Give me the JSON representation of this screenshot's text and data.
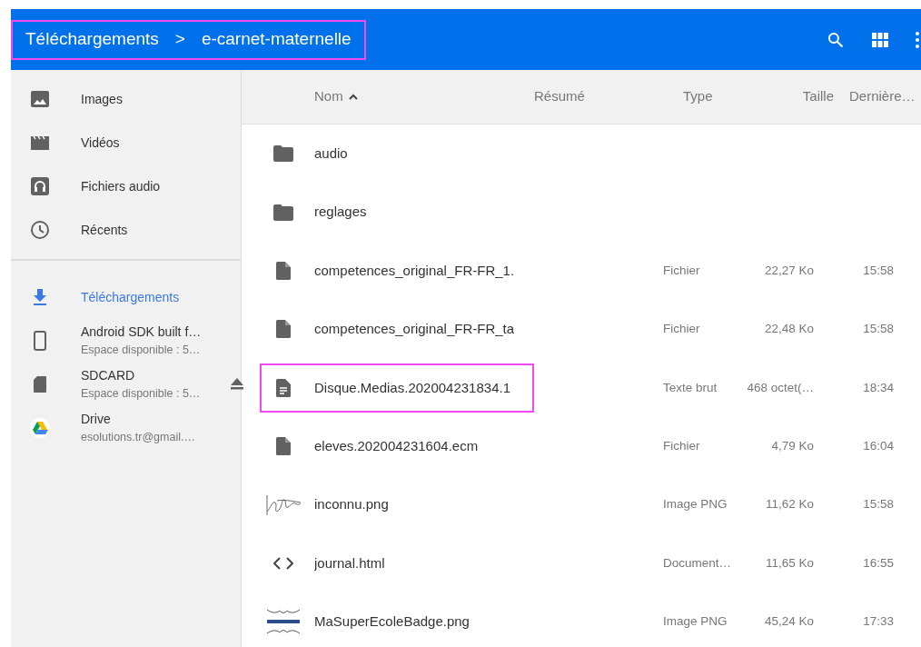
{
  "toolbar": {
    "breadcrumb": [
      "Téléchargements",
      "e-carnet-maternelle"
    ],
    "separator": ">",
    "highlighted": true
  },
  "sidebar": {
    "groups": [
      {
        "items": [
          {
            "label": "Images",
            "selected": false
          },
          {
            "label": "Vidéos",
            "selected": false
          },
          {
            "label": "Fichiers audio",
            "selected": false
          },
          {
            "label": "Récents",
            "selected": false
          }
        ]
      },
      {
        "items": [
          {
            "label": "Téléchargements",
            "selected": true
          },
          {
            "label": "Android SDK built f…",
            "subtitle": "Espace disponible : 5…",
            "selected": false,
            "ejectable": false
          },
          {
            "label": "SDCARD",
            "subtitle": "Espace disponible : 5…",
            "selected": false,
            "ejectable": true
          },
          {
            "label": "Drive",
            "subtitle": "esolutions.tr@gmail.…",
            "selected": false,
            "ejectable": false
          }
        ]
      }
    ]
  },
  "table": {
    "columns": [
      {
        "label": "Nom",
        "sorted": true
      },
      {
        "label": "Résumé",
        "sorted": false
      },
      {
        "label": "Type",
        "sorted": false
      },
      {
        "label": "Taille",
        "sorted": false
      },
      {
        "label": "Dernière…",
        "sorted": false
      }
    ],
    "rows": [
      {
        "kind": "folder",
        "name": "audio",
        "highlighted": false
      },
      {
        "kind": "folder",
        "name": "reglages",
        "highlighted": false
      },
      {
        "kind": "file",
        "name": "competences_original_FR-FR_1.",
        "type": "Fichier",
        "size": "22,27 Ko",
        "modified": "15:58",
        "highlighted": false
      },
      {
        "kind": "file",
        "name": "competences_original_FR-FR_ta",
        "type": "Fichier",
        "size": "22,48 Ko",
        "modified": "15:58",
        "highlighted": false
      },
      {
        "kind": "text",
        "name": "Disque.Medias.202004231834.1",
        "type": "Texte brut",
        "size": "468 octet(…",
        "modified": "18:34",
        "highlighted": true
      },
      {
        "kind": "file",
        "name": "eleves.202004231604.ecm",
        "type": "Fichier",
        "size": "4,79 Ko",
        "modified": "16:04",
        "highlighted": false
      },
      {
        "kind": "sketch",
        "name": "inconnu.png",
        "type": "Image PNG",
        "size": "11,62 Ko",
        "modified": "15:58",
        "highlighted": false
      },
      {
        "kind": "code",
        "name": "journal.html",
        "type": "Document…",
        "size": "11,65 Ko",
        "modified": "16:55",
        "highlighted": false
      },
      {
        "kind": "badge",
        "name": "MaSuperEcoleBadge.png",
        "type": "Image PNG",
        "size": "45,24 Ko",
        "modified": "17:33",
        "highlighted": false
      }
    ]
  }
}
